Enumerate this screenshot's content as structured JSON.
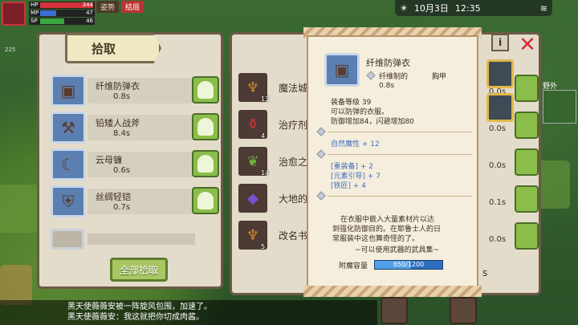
{
  "hud": {
    "hp_label": "HP",
    "hp_value": "344",
    "mp_label": "MP",
    "mp_value": "47",
    "sp_label": "SP",
    "sp_value": "46",
    "level_text": "225",
    "tabs": [
      "姿势",
      "结局"
    ]
  },
  "datebar": {
    "date": "10月3日",
    "time": "12:35"
  },
  "pickup": {
    "title": "拾取",
    "items": [
      {
        "name": "纤维防弹衣",
        "time": "0.8s",
        "icon": "armor-vest-icon"
      },
      {
        "name": "铅矮人战斧",
        "time": "8.4s",
        "icon": "axe-icon"
      },
      {
        "name": "云母镰",
        "time": "0.6s",
        "icon": "sickle-icon"
      },
      {
        "name": "丝绸轻铠",
        "time": "0.7s",
        "icon": "light-armor-icon"
      }
    ],
    "pick_all_label": "全部拾取"
  },
  "inventory": {
    "rows": [
      {
        "name": "魔法城",
        "count": "13",
        "time": "0.0s"
      },
      {
        "name": "治疗剂",
        "count": "4",
        "time": "0.0s"
      },
      {
        "name": "治愈之",
        "count": "14",
        "time": "0.0s"
      },
      {
        "name": "大地的",
        "count": "",
        "time": "0.1s"
      },
      {
        "name": "改名书",
        "count": "5",
        "time": "0.0s"
      }
    ],
    "partial_text": "s"
  },
  "tooltip": {
    "name": "纤维防弹衣",
    "material": "纤维制的",
    "slot": "胸甲",
    "weight": "0.8s",
    "equip_level": "装备等级 39",
    "desc1": "可以防弹的衣服。",
    "stats": "防御增加84，闪避增加80",
    "attr1": "自然魔性 + 12",
    "attr2": "[重装备] + 2",
    "attr3": "[元素引导] + 7",
    "attr4": "[铁匠] + 4",
    "lore1": "在衣服中嵌入大量素材片以达",
    "lore2": "到强化防御目的。在耶鲁士人的日",
    "lore3": "常服装中这也算奇怪的了。",
    "lore4": "~可以使用武器的武具集~",
    "magic_label": "附魔容量",
    "magic_value": "650/1200",
    "magic_fraction": 0.54
  },
  "right": {
    "info": "i",
    "close": "✕",
    "field": "野外"
  },
  "chat": {
    "line1": "黑天使薇薇安被一阵旋风包围，加速了。",
    "line2": "黑天使薇薇安：我这就把你切成肉酱。"
  },
  "colors": {
    "accent_green": "#8bbd4a",
    "hp": "#d3323a",
    "mp": "#3b6fd1",
    "sp": "#3aa842"
  }
}
